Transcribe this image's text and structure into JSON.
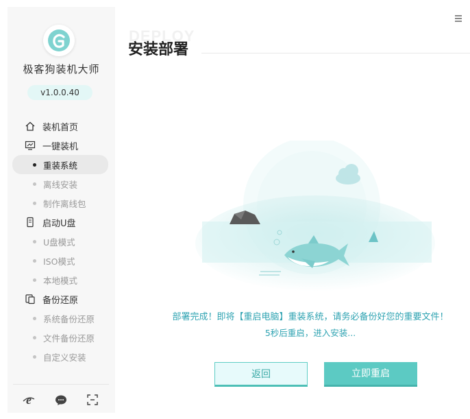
{
  "app": {
    "name": "极客狗装机大师",
    "version": "v1.0.0.40"
  },
  "sidebar": {
    "groups": [
      {
        "label": "装机首页",
        "icon": "home-icon",
        "items": []
      },
      {
        "label": "一键装机",
        "icon": "monitor-icon",
        "items": [
          {
            "label": "重装系统",
            "active": true
          },
          {
            "label": "离线安装",
            "active": false
          },
          {
            "label": "制作离线包",
            "active": false
          }
        ]
      },
      {
        "label": "启动U盘",
        "icon": "usb-icon",
        "items": [
          {
            "label": "U盘模式",
            "active": false
          },
          {
            "label": "ISO模式",
            "active": false
          },
          {
            "label": "本地模式",
            "active": false
          }
        ]
      },
      {
        "label": "备份还原",
        "icon": "backup-icon",
        "items": [
          {
            "label": "系统备份还原",
            "active": false
          },
          {
            "label": "文件备份还原",
            "active": false
          },
          {
            "label": "自定义安装",
            "active": false
          }
        ]
      }
    ],
    "footer_icons": [
      "ie-browser-icon",
      "chat-support-icon",
      "screenshot-icon"
    ]
  },
  "header": {
    "watermark": "DEPLOY",
    "title": "安装部署",
    "menu_icon": "hamburger-menu-icon"
  },
  "main": {
    "message_line1": "部署完成！即将【重启电脑】重装系统，请务必备份好您的重要文件！",
    "message_line2": "5秒后重启，进入安装...",
    "back_button": "返回",
    "restart_button": "立即重启"
  },
  "colors": {
    "accent": "#5ccac3",
    "message_text": "#2fa3b2",
    "sidebar_bg": "#f7f7f7"
  }
}
